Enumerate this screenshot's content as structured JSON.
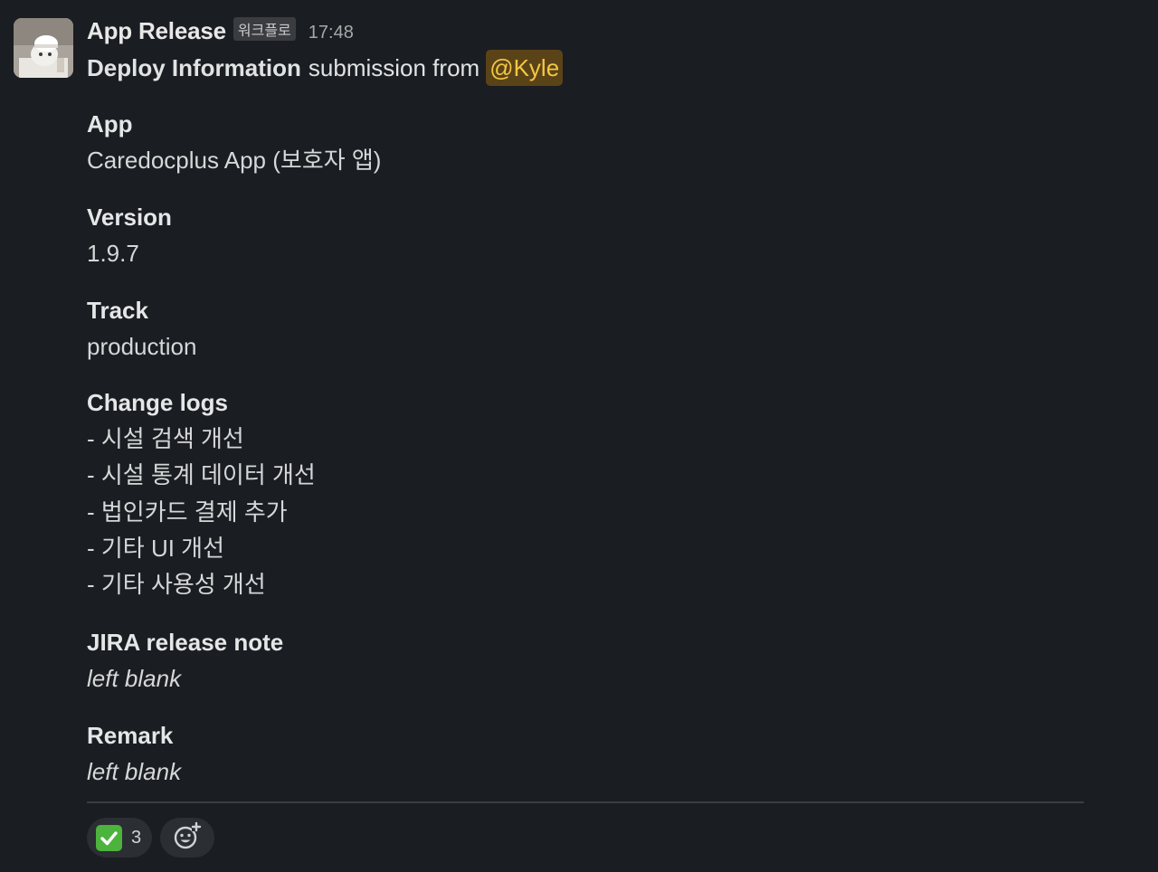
{
  "message": {
    "sender": "App Release",
    "badge": "워크플로",
    "time": "17:48",
    "intro": {
      "form_name": "Deploy Information",
      "text": "submission from",
      "mention": "@Kyle"
    }
  },
  "fields": [
    {
      "title": "App",
      "value": "Caredocplus App (보호자 앱)"
    },
    {
      "title": "Version",
      "value": "1.9.7"
    },
    {
      "title": "Track",
      "value": "production"
    },
    {
      "title": "Change logs",
      "lines": [
        "- 시설 검색 개선",
        "- 시설 통계 데이터 개선",
        "- 법인카드 결제 추가",
        "- 기타 UI 개선",
        "- 기타 사용성 개선"
      ]
    },
    {
      "title": "JIRA release note",
      "value": "left blank"
    },
    {
      "title": "Remark",
      "value": "left blank"
    }
  ],
  "reactions": [
    {
      "emoji": "white-check-mark-icon",
      "count": "3"
    }
  ],
  "add_reaction_icon": "add-reaction-icon",
  "colors": {
    "background": "#1a1d21",
    "mention_bg": "#5b4318",
    "mention_text": "#f2c744",
    "check_green": "#4cb33c"
  }
}
